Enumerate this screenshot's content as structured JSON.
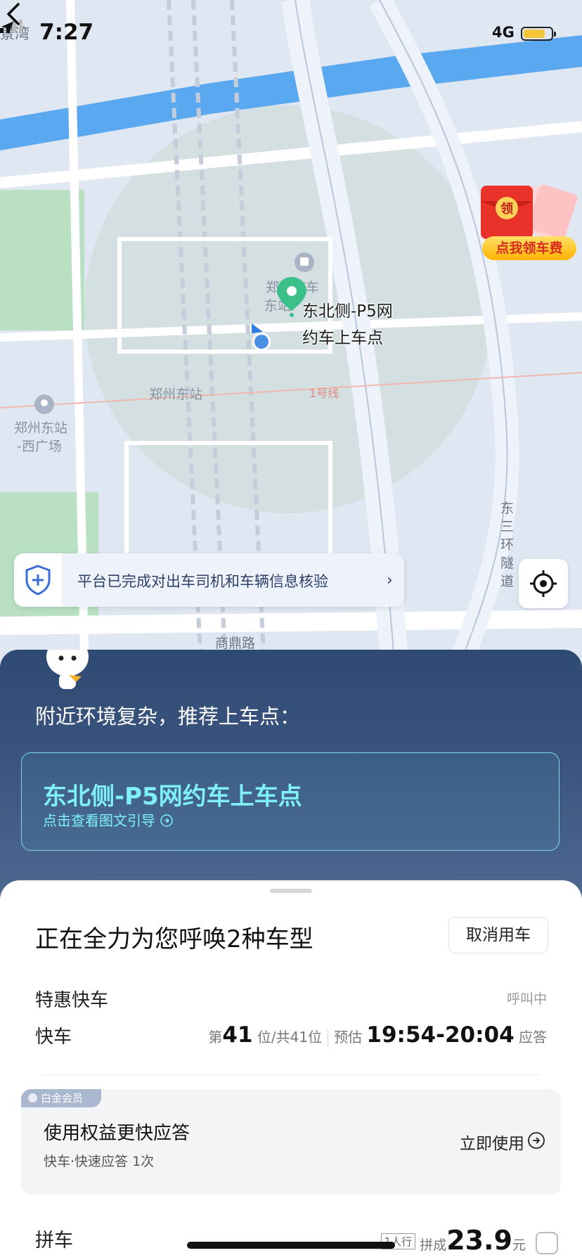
{
  "status_bar": {
    "carrier": "景湾",
    "time": "7:27",
    "network": "4G"
  },
  "map": {
    "labels": {
      "station_building": "郑州汽车",
      "station_building_2": "东站",
      "zhengzhou_east": "郑州东站",
      "west_square_1": "郑州东站",
      "west_square_2": "-西广场",
      "metro_line": "1号线",
      "shangding_road": "商鼎路",
      "tunnel": "东三环隧道"
    },
    "pickup_label_line1": "东北侧-P5网",
    "pickup_label_line2": "约车上车点",
    "promo_badge": "领",
    "promo_text": "点我领车费",
    "verify_banner": "平台已完成对出车司机和车辆信息核验",
    "colors": {
      "map_bg": "#dfe7f3",
      "river": "#5aa8ef",
      "road": "#ffffff",
      "green": "#b9e0c3",
      "radius": "#c9d9cf",
      "pin": "#3cc08a",
      "user_dot": "#4a90e2"
    }
  },
  "recommend": {
    "headline": "附近环境复杂，推荐上车点：",
    "spot_title": "东北侧-P5网约车上车点",
    "spot_sub": "点击查看图文引导"
  },
  "sheet": {
    "calling_title": "正在全力为您呼唤2种车型",
    "cancel_button": "取消用车",
    "ride1_name": "特惠快车",
    "ride1_status": "呼叫中",
    "ride2_name": "快车",
    "queue_prefix": "第",
    "queue_position": "41",
    "queue_mid": "位",
    "queue_total": "/共41位",
    "eta_prefix": "预估",
    "eta_time": "19:54-20:04",
    "eta_suffix": "应答",
    "member_badge": "白金会员",
    "member_title": "使用权益更快应答",
    "member_desc": "快车·快速应答 1次",
    "member_action": "立即使用",
    "carpool_name": "拼车",
    "carpool_tag": "1人行",
    "carpool_prefix": "拼成",
    "carpool_price": "23.9",
    "carpool_unit": "元"
  }
}
